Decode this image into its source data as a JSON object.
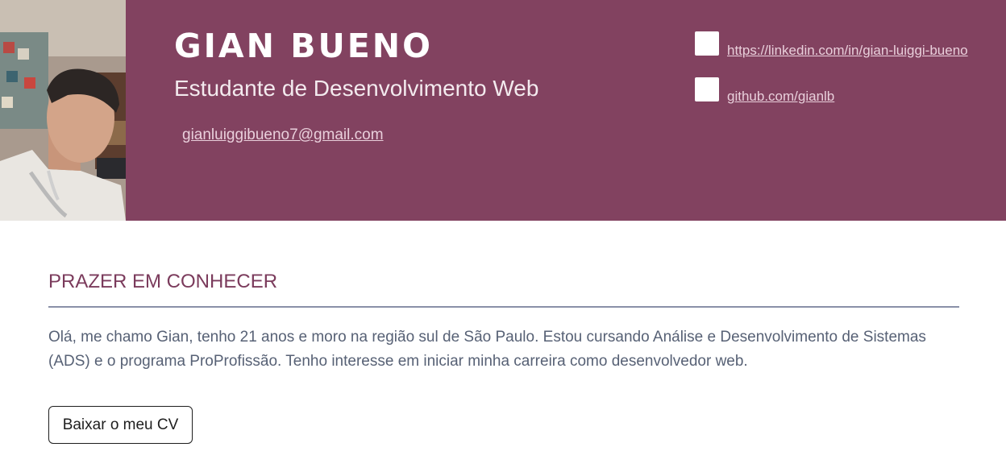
{
  "profile": {
    "name": "GIAN BUENO",
    "title": "Estudante de Desenvolvimento Web",
    "email": "gianluiggibueno7@gmail.com"
  },
  "links": [
    {
      "icon": "linkedin-icon",
      "text": "https://linkedin.com/in/gian-luiggi-bueno"
    },
    {
      "icon": "github-icon",
      "text": "github.com/gianlb"
    }
  ],
  "about": {
    "heading": "PRAZER EM CONHECER",
    "text": "Olá, me chamo Gian, tenho 21 anos e moro na região sul de São Paulo. Estou cursando Análise e Desenvolvimento de Sistemas (ADS) e o programa ProProfissão. Tenho interesse em iniciar minha carreira como desenvolvedor web."
  },
  "actions": {
    "cv_button": "Baixar o meu CV"
  },
  "colors": {
    "header_bg": "#824260",
    "accent": "#7b3b5c",
    "body_text": "#576175"
  }
}
